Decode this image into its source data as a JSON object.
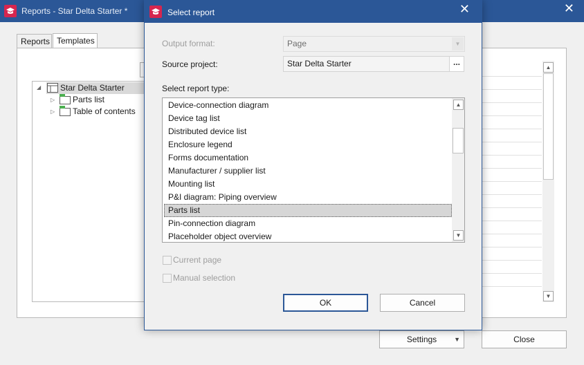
{
  "background_window": {
    "title": "Reports - Star Delta Starter *",
    "close_glyph": "✕",
    "tabs": [
      "Reports",
      "Templates"
    ],
    "tree": {
      "root": "Star Delta Starter",
      "children": [
        "Parts list",
        "Table of contents"
      ]
    },
    "buttons": {
      "settings": "Settings",
      "close": "Close"
    }
  },
  "dialog": {
    "title": "Select report",
    "close_glyph": "✕",
    "output_format_label": "Output format:",
    "output_format_value": "Page",
    "source_project_label": "Source project:",
    "source_project_value": "Star Delta Starter",
    "browse_label": "...",
    "report_type_label": "Select report type:",
    "report_types": [
      "Device-connection diagram",
      "Device tag list",
      "Distributed device list",
      "Enclosure legend",
      "Forms documentation",
      "Manufacturer / supplier list",
      "Mounting list",
      "P&I diagram: Piping overview",
      "Parts list",
      "Pin-connection diagram",
      "Placeholder object overview"
    ],
    "selected_report_type": "Parts list",
    "current_page_label": "Current page",
    "manual_selection_label": "Manual selection",
    "ok_label": "OK",
    "cancel_label": "Cancel"
  },
  "colors": {
    "titlebar": "#2b5797",
    "app_icon": "#d6264f",
    "selection": "#d6d6d6"
  },
  "icons": {
    "app": "mortarboard-icon",
    "folder": "folder-icon",
    "template": "table-icon",
    "scroll_up": "triangle-up-icon",
    "scroll_down": "triangle-down-icon",
    "dropdown": "chevron-down-icon"
  }
}
